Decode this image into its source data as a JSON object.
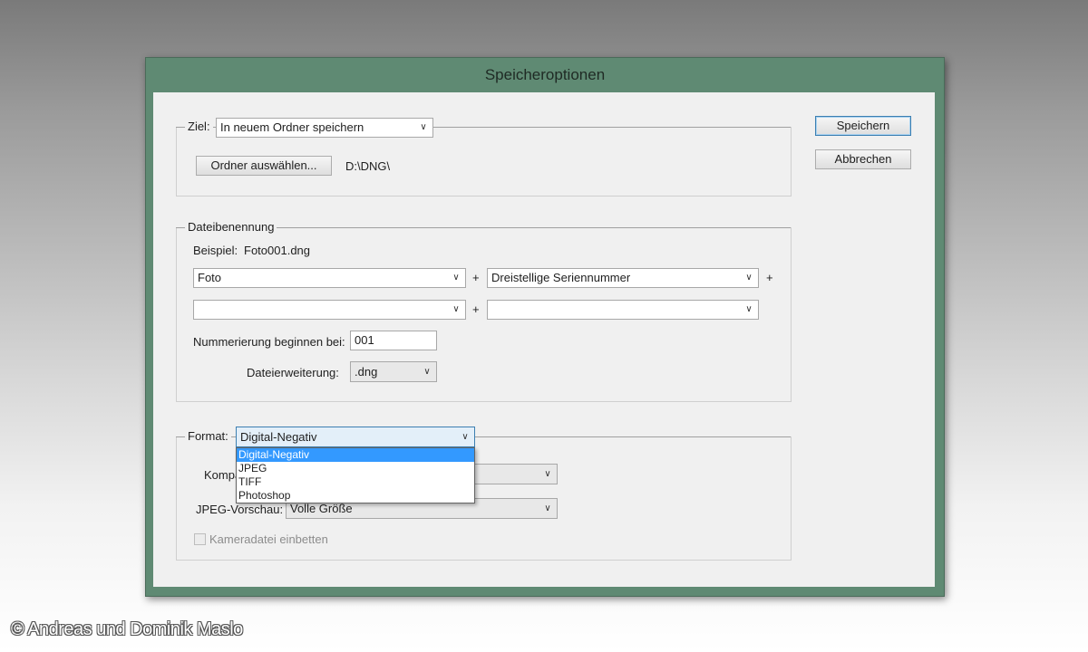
{
  "window": {
    "title": "Speicheroptionen"
  },
  "buttons": {
    "save": "Speichern",
    "cancel": "Abbrechen"
  },
  "destination": {
    "label": "Ziel:",
    "selected": "In neuem Ordner speichern",
    "choose_folder_button": "Ordner auswählen...",
    "path": "D:\\DNG\\"
  },
  "naming": {
    "legend": "Dateibenennung",
    "example_label": "Beispiel:",
    "example_value": "Foto001.dng",
    "plus": "+",
    "row1": {
      "field1": "Foto",
      "field2": "Dreistellige Seriennummer"
    },
    "row2": {
      "field1": "",
      "field2": ""
    },
    "start_label": "Nummerierung beginnen bei:",
    "start_value": "001",
    "ext_label": "Dateierweiterung:",
    "ext_value": ".dng"
  },
  "format": {
    "label": "Format:",
    "selected": "Digital-Negativ",
    "options": [
      "Digital-Negativ",
      "JPEG",
      "TIFF",
      "Photoshop"
    ],
    "compat_label": "Kompa",
    "jpeg_preview_label": "JPEG-Vorschau:",
    "jpeg_preview_value": "Volle Größe",
    "embed_label": "Kameradatei einbetten"
  },
  "credit": "© Andreas und Dominik Maslo",
  "colors": {
    "titlebar": "#5f8a73",
    "selection": "#3399ff",
    "default_button_border": "#3c7fb1"
  }
}
